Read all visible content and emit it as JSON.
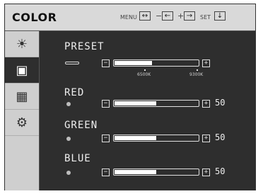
{
  "header": {
    "title": "COLOR",
    "menu_label": "MENU",
    "minus_label": "−",
    "plus_label": "+",
    "set_label": "SET",
    "key_menu": "↔",
    "key_minus": "←",
    "key_plus": "→",
    "key_set": "↓"
  },
  "sidebar": {
    "tabs": [
      {
        "icon": "brightness-icon",
        "glyph": "☀",
        "active": false
      },
      {
        "icon": "color-icon",
        "glyph": "▣",
        "active": true
      },
      {
        "icon": "image-icon",
        "glyph": "▦",
        "active": false
      },
      {
        "icon": "setup-gear-icon",
        "glyph": "⚙",
        "active": false
      }
    ]
  },
  "settings": {
    "preset": {
      "label": "PRESET",
      "min_label": "6500K",
      "max_label": "9300K",
      "level": 0.45
    },
    "red": {
      "label": "RED",
      "value": "50",
      "level": 0.5
    },
    "green": {
      "label": "GREEN",
      "value": "50",
      "level": 0.5
    },
    "blue": {
      "label": "BLUE",
      "value": "50",
      "level": 0.5
    }
  },
  "colors": {
    "panel": "#2e2e2e",
    "header": "#d9d9d9",
    "sidebar": "#cfcfcf",
    "text": "#eeeeee"
  }
}
